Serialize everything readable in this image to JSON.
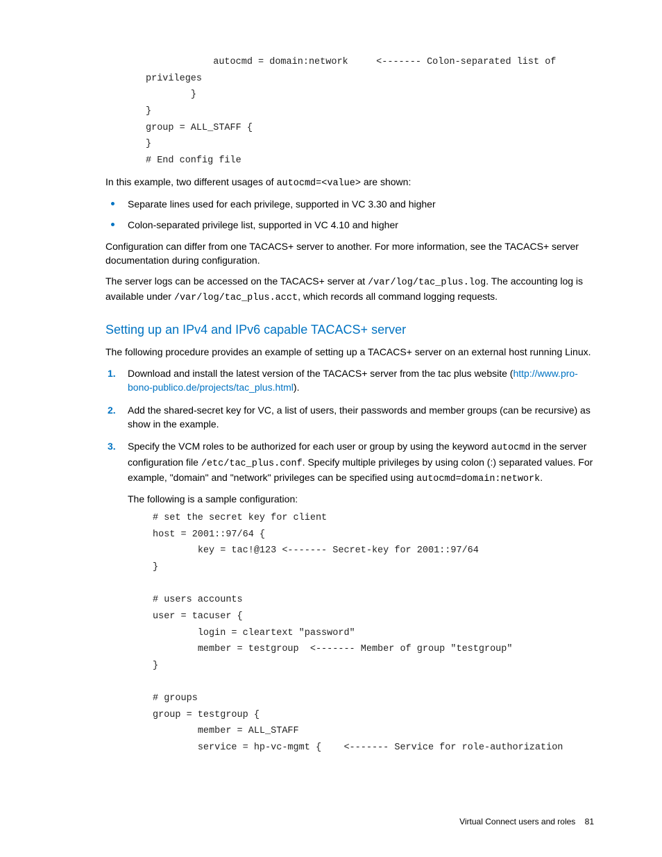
{
  "code_block_1": "            autocmd = domain:network     <------- Colon-separated list of privileges\n        }\n}\ngroup = ALL_STAFF {\n}\n# End config file",
  "intro_para_pre": "In this example, two different usages of ",
  "intro_code": "autocmd=<value>",
  "intro_para_post": " are shown:",
  "bullets": {
    "b1": "Separate lines used for each privilege, supported in VC 3.30 and higher",
    "b2": "Colon-separated privilege list, supported in VC 4.10 and higher"
  },
  "para_config": "Configuration can differ from one TACACS+ server to another. For more information, see the TACACS+ server documentation during configuration.",
  "para_logs_1": "The server logs can be accessed on the TACACS+ server at ",
  "code_log1": "/var/log/tac_plus.log",
  "para_logs_2": ". The accounting log is available under ",
  "code_log2": "/var/log/tac_plus.acct",
  "para_logs_3": ", which records all command logging requests.",
  "section_heading": "Setting up an IPv4 and IPv6 capable TACACS+ server",
  "section_intro": "The following procedure provides an example of setting up a TACACS+ server on an external host running Linux.",
  "steps": {
    "s1_pre": "Download and install the latest version of the TACACS+ server from the tac plus website (",
    "s1_link": "http://www.pro-bono-publico.de/projects/tac_plus.html",
    "s1_post": ").",
    "s2": "Add the shared-secret key for VC, a list of users, their passwords and member groups (can be recursive) as show in the example.",
    "s3_pre": "Specify the VCM roles to be authorized for each user or group by using the keyword ",
    "s3_code1": "autocmd",
    "s3_mid1": " in the server configuration file ",
    "s3_code2": "/etc/tac_plus.conf",
    "s3_mid2": ". Specify multiple privileges by using colon (:) separated values. For example, \"domain\" and \"network\" privileges can be specified using ",
    "s3_code3": "autocmd=domain:network",
    "s3_post": ".",
    "s3_sub": "The following is a sample configuration:"
  },
  "code_block_2": "# set the secret key for client\nhost = 2001::97/64 {\n        key = tac!@123 <------- Secret-key for 2001::97/64\n}\n\n# users accounts\nuser = tacuser {\n        login = cleartext \"password\"\n        member = testgroup  <------- Member of group \"testgroup\"\n}\n\n# groups\ngroup = testgroup {\n        member = ALL_STAFF\n        service = hp-vc-mgmt {    <------- Service for role-authorization",
  "footer_text": "Virtual Connect users and roles",
  "footer_page": "81"
}
